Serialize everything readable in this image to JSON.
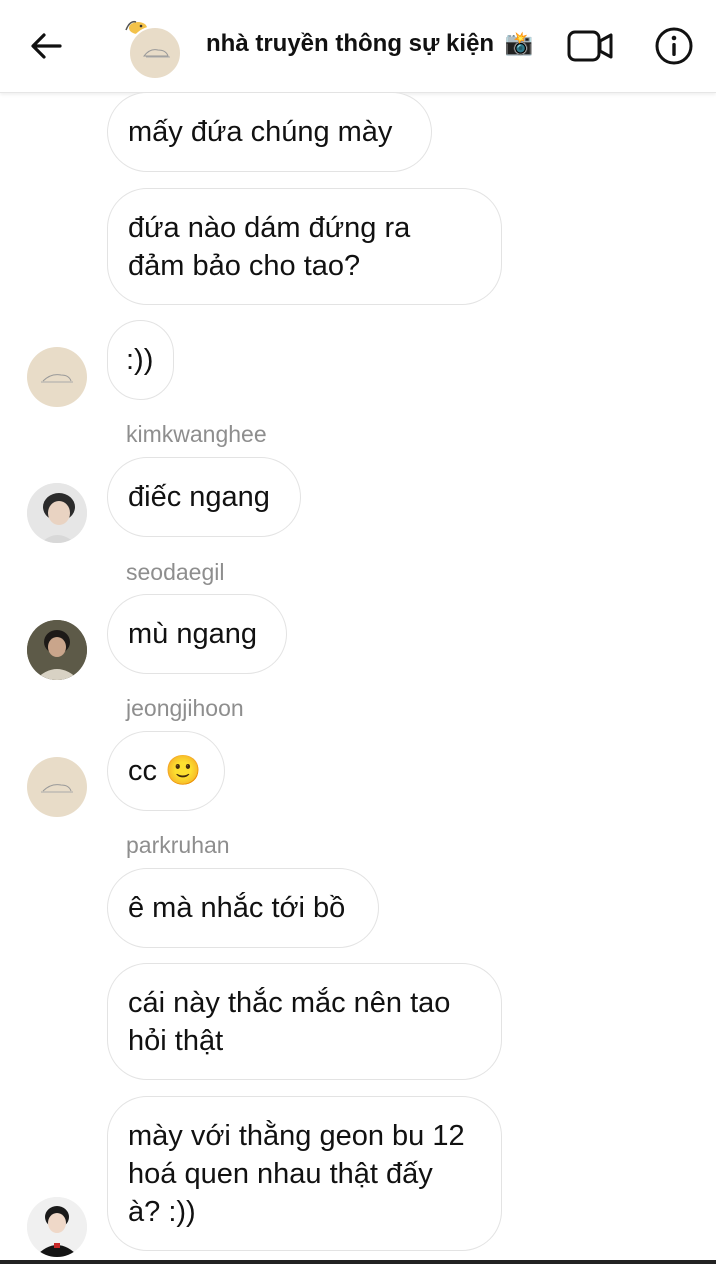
{
  "header": {
    "title": "nhà truyền thông sự kiện",
    "title_emoji": "📸",
    "icons": [
      "arrow-left-icon",
      "video-camera-icon",
      "info-icon"
    ]
  },
  "messages": [
    {
      "text": "mấy đứa chúng mày"
    },
    {
      "text": "đứa nào dám đứng ra đảm bảo cho tao?"
    },
    {
      "text": ":))"
    },
    {
      "sender": "kimkwanghee",
      "text": "điếc ngang"
    },
    {
      "sender": "seodaegil",
      "text": "mù ngang"
    },
    {
      "sender": "jeongjihoon",
      "text": "cc 🙂"
    },
    {
      "sender": "parkruhan",
      "text": "ê mà nhắc tới bồ"
    },
    {
      "text": "cái này thắc mắc nên tao hỏi thật"
    },
    {
      "text": "mày với thằng geon bu 12 hoá quen nhau thật đấy à? :))"
    }
  ],
  "colors": {
    "bubble_border": "#e3e3e3",
    "sender_name": "#8e8e8e",
    "avatar_beige": "#e8dcc8"
  }
}
